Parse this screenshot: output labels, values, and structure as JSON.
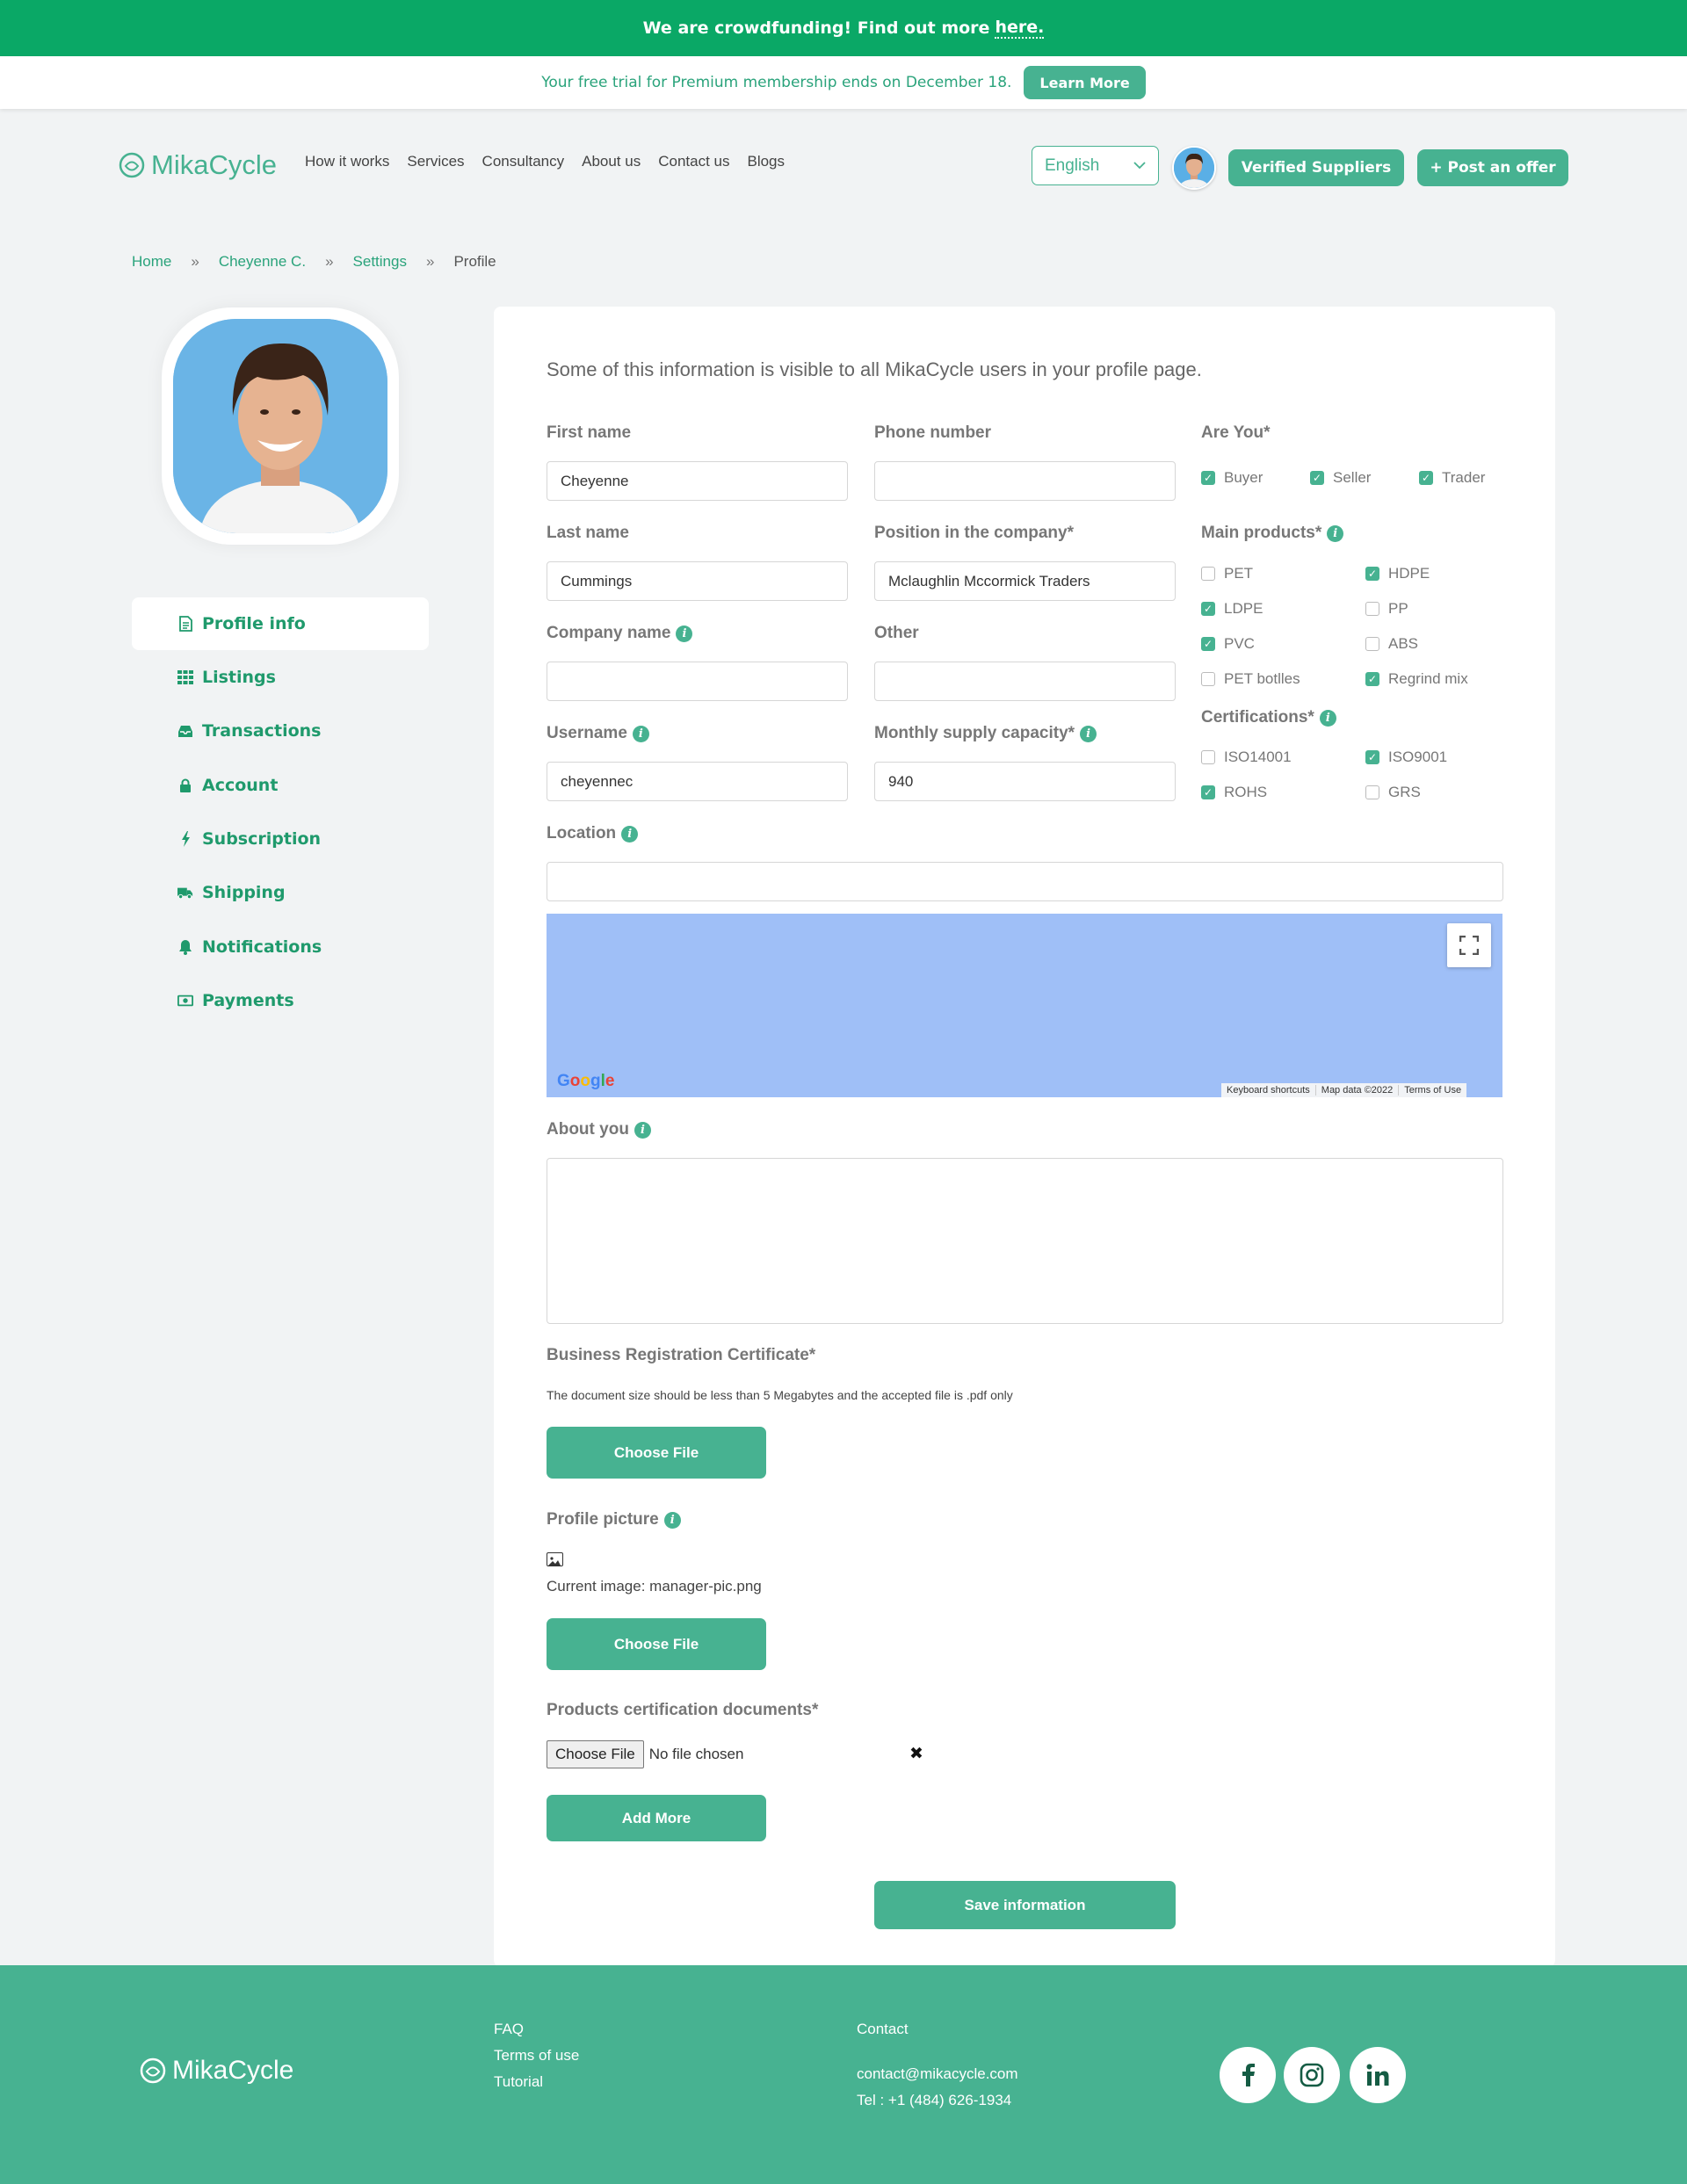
{
  "banner": {
    "text": "We are crowdfunding! Find out more",
    "link": "here."
  },
  "trial": {
    "text": "Your free trial for Premium membership ends on December 18.",
    "button": "Learn More"
  },
  "brand": {
    "name": "MikaCycle"
  },
  "nav": {
    "items": [
      "How it works",
      "Services",
      "Consultancy",
      "About us",
      "Contact us",
      "Blogs"
    ]
  },
  "language": {
    "selected": "English"
  },
  "header_buttons": {
    "verified": "Verified Suppliers",
    "post": "+ Post an offer"
  },
  "breadcrumb": {
    "sep": "»",
    "items": [
      "Home",
      "Cheyenne C.",
      "Settings",
      "Profile"
    ]
  },
  "sidebar": {
    "items": [
      {
        "label": "Profile info",
        "icon": "file-text-icon",
        "active": true
      },
      {
        "label": "Listings",
        "icon": "grid-icon"
      },
      {
        "label": "Transactions",
        "icon": "inbox-icon"
      },
      {
        "label": "Account",
        "icon": "lock-icon"
      },
      {
        "label": "Subscription",
        "icon": "bolt-icon"
      },
      {
        "label": "Shipping",
        "icon": "truck-icon"
      },
      {
        "label": "Notifications",
        "icon": "bell-icon"
      },
      {
        "label": "Payments",
        "icon": "money-icon"
      }
    ]
  },
  "form": {
    "intro": "Some of this information is visible to all MikaCycle users in your profile page.",
    "first_name": {
      "label": "First name",
      "value": "Cheyenne"
    },
    "phone": {
      "label": "Phone number",
      "value": ""
    },
    "last_name": {
      "label": "Last name",
      "value": "Cummings"
    },
    "position": {
      "label": "Position in the company*",
      "value": "Mclaughlin Mccormick Traders"
    },
    "company": {
      "label": "Company name",
      "value": ""
    },
    "other": {
      "label": "Other",
      "value": ""
    },
    "username": {
      "label": "Username",
      "value": "cheyennec"
    },
    "capacity": {
      "label": "Monthly supply capacity*",
      "value": "940"
    },
    "are_you": {
      "label": "Are You*",
      "options": [
        {
          "label": "Buyer",
          "checked": true
        },
        {
          "label": "Seller",
          "checked": true
        },
        {
          "label": "Trader",
          "checked": true
        }
      ]
    },
    "main_products": {
      "label": "Main products*",
      "options": [
        {
          "label": "PET",
          "checked": false
        },
        {
          "label": "HDPE",
          "checked": true
        },
        {
          "label": "LDPE",
          "checked": true
        },
        {
          "label": "PP",
          "checked": false
        },
        {
          "label": "PVC",
          "checked": true
        },
        {
          "label": "ABS",
          "checked": false
        },
        {
          "label": "PET botlles",
          "checked": false
        },
        {
          "label": "Regrind mix",
          "checked": true
        }
      ]
    },
    "certifications": {
      "label": "Certifications*",
      "options": [
        {
          "label": "ISO14001",
          "checked": false
        },
        {
          "label": "ISO9001",
          "checked": true
        },
        {
          "label": "ROHS",
          "checked": true
        },
        {
          "label": "GRS",
          "checked": false
        }
      ]
    },
    "location": {
      "label": "Location",
      "value": ""
    },
    "map": {
      "logo": "Google",
      "shortcuts": "Keyboard shortcuts",
      "data": "Map data ©2022",
      "terms": "Terms of Use"
    },
    "about": {
      "label": "About you",
      "value": ""
    },
    "brc": {
      "label": "Business Registration Certificate*",
      "note": "The document size should be less than 5 Megabytes and the accepted file is .pdf only",
      "button": "Choose File"
    },
    "picture": {
      "label": "Profile picture",
      "current": "Current image: manager-pic.png",
      "button": "Choose File"
    },
    "cert_docs": {
      "label": "Products certification documents*",
      "native_button": "Choose File",
      "native_status": "No file chosen",
      "remove": "✖",
      "add_more": "Add More"
    },
    "save": "Save information"
  },
  "footer": {
    "links": [
      "FAQ",
      "Terms of use",
      "Tutorial"
    ],
    "contact_title": "Contact",
    "email": "contact@mikacycle.com",
    "tel": "Tel : +1 (484) 626-1934",
    "social": [
      "f",
      "ig",
      "in"
    ]
  },
  "colors": {
    "brand": "#47b291",
    "banner": "#0aa866",
    "map": "#9fbff7"
  }
}
